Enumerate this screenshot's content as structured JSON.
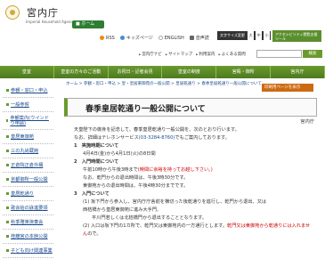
{
  "header": {
    "title": "宮内庁",
    "subtitle": "Imperial Household Agency",
    "home_label": "ホーム",
    "util_links": [
      "RSS",
      "キッズページ",
      "ENGLISH",
      "音声読"
    ],
    "font_size_label": "文字サイズ変更",
    "font_sizes": [
      "大",
      "中",
      "小"
    ],
    "accessibility_label": "アクセシビリティ閲覧支援ツール",
    "sub_links": [
      "宮内庁ナビ",
      "サイトマップ",
      "利用案内",
      "よくある質問"
    ],
    "search_button": "検索"
  },
  "navbar": [
    "皇室",
    "皇室の方々のご活動",
    "お祝日・記者会見",
    "皇室の制度",
    "宮殿・御所",
    "宮内庁"
  ],
  "sidebar": [
    "参観・窓口・申込",
    "一般参賀",
    "参観案内(ウインドウ申請)",
    "皇居東御苑",
    "三の丸尚蔵館",
    "正倉院正倉外構",
    "京都御所一般公開",
    "皇居乾通り",
    "歌会始の詠進要領",
    "秋季雅楽演奏会",
    "桂離宮の本館公開",
    "子ども向け関連事業"
  ],
  "breadcrumb": "ホーム > 参観・窓口・申込 > 皇・皇居東御苑の一般公開 > 皇居乾通り > 春季皇居乾通り一般公開について",
  "print_label": "印刷用ページを表示",
  "page_title": "春季皇居乾通り一般公開について",
  "content": {
    "org": "宮内庁",
    "intro1": "天皇陛下の御身を記念して、春季皇居乾通り一般公開を、次のとおり行います。",
    "intro2": "なお、詳細はテレホンサービス",
    "phone": "(03-3284-8760)",
    "intro2_end": "でもご案内しております。",
    "s1_head": "1　実施時期について",
    "s1_body": "4月4日(金)から4月1日(火)の8日間",
    "s2_head": "2　入門時間について",
    "s2_body1": "午前10時から午後3時まで",
    "s2_body1_red": "(時間に余裕を持ってお越し下さい。)",
    "s2_body2": "なお、乾門からの退出時間は、午後3時30分です。",
    "s2_body3": "東御苑からの退出時間は、午後4時30分までです。",
    "s3_head": "3　入門について",
    "s3_body1": "(1) 坂下門から参入し、宮内庁庁舎前を横切った後乾通りを進行し、乾門から退出、又は",
    "s3_body2": "西桔橋から皇居東御苑に進み大手門、",
    "s3_body3": "平川門若しくは北桔橋門から退出することとなります。",
    "s3_body4a": "(2) 入口は坂下門の1カ所で、乾門又は東御苑内の一方通行とします。",
    "s3_body4b": "乾門又は東御苑から乾通りには入れません",
    "s3_body4c": "ので。"
  }
}
